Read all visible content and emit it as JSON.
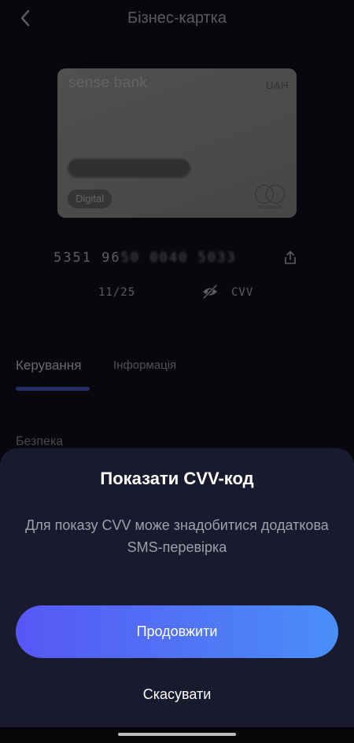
{
  "header": {
    "title": "Бізнес-картка",
    "back_icon": "chevron-left-icon"
  },
  "card": {
    "brand": "sense bank",
    "currency": "UAH",
    "badge": "Digital",
    "network_icon": "mastercard-logo",
    "network_text": "mastercard",
    "number_visible": "5351 96",
    "number_masked": "50 0040 5033",
    "expiry": "11/25",
    "cvv_label": "CVV",
    "share_icon": "share-icon",
    "eye_icon": "eye-off-icon"
  },
  "tabs": [
    {
      "label": "Керування",
      "active": true
    },
    {
      "label": "Інформація",
      "active": false
    }
  ],
  "section": {
    "security": "Безпека"
  },
  "sheet": {
    "title": "Показати CVV-код",
    "description": "Для показу CVV може знадобитися додаткова SMS-перевірка",
    "continue_label": "Продовжити",
    "cancel_label": "Скасувати"
  },
  "colors": {
    "accent_start": "#5757f4",
    "accent_end": "#4a8ff8",
    "sheet_bg": "#191a2e",
    "tab_indicator": "#3a48a2"
  }
}
